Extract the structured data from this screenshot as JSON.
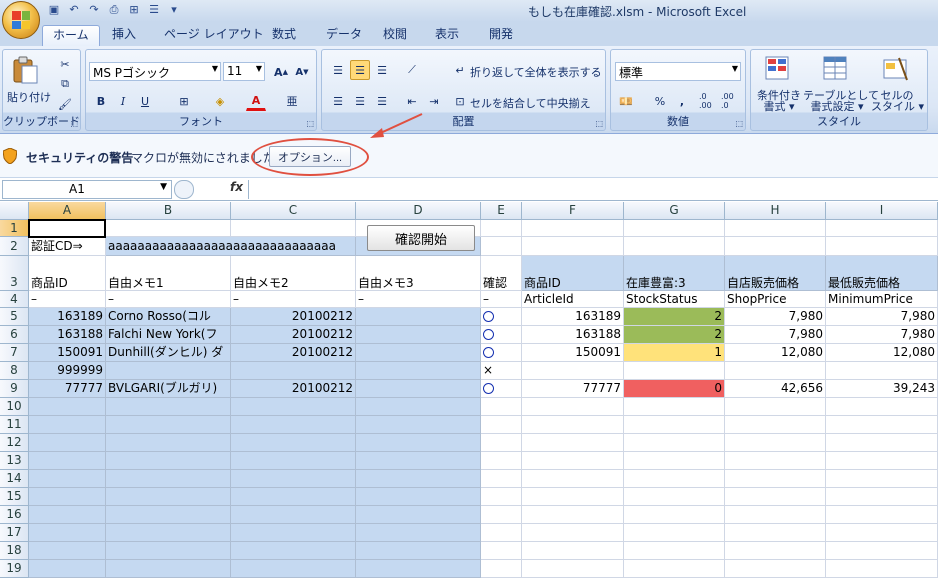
{
  "title": "もしも在庫確認.xlsm - Microsoft Excel",
  "tabs": [
    "ホーム",
    "挿入",
    "ページ レイアウト",
    "数式",
    "データ",
    "校閲",
    "表示",
    "開発"
  ],
  "clipboard": {
    "paste": "貼り付け",
    "group": "クリップボード"
  },
  "font": {
    "name": "MS Pゴシック",
    "size": "11",
    "group": "フォント"
  },
  "align": {
    "wrap": "折り返して全体を表示する",
    "merge": "セルを結合して中央揃え",
    "group": "配置"
  },
  "number": {
    "format": "標準",
    "group": "数値"
  },
  "styles": {
    "cond1": "条件付き",
    "cond2": "書式",
    "table1": "テーブルとして",
    "table2": "書式設定",
    "cell1": "セルの",
    "cell2": "スタイル",
    "group": "スタイル"
  },
  "security": {
    "title": "セキュリティの警告",
    "message": "マクロが無効にされました。",
    "options": "オプション..."
  },
  "formula": {
    "namebox": "A1",
    "fx": "fx",
    "value": ""
  },
  "columns": [
    "A",
    "B",
    "C",
    "D",
    "E",
    "F",
    "G",
    "H",
    "I"
  ],
  "rows": [
    "1",
    "2",
    "3",
    "4",
    "5",
    "6",
    "7",
    "8",
    "9",
    "10",
    "11",
    "12",
    "13",
    "14",
    "15",
    "16",
    "17",
    "18",
    "19"
  ],
  "start_button": "確認開始",
  "row2": {
    "label": "認証CD⇒",
    "value": "aaaaaaaaaaaaaaaaaaaaaaaaaaaaaaa"
  },
  "headers": [
    "商品ID",
    "自由メモ1",
    "自由メモ2",
    "自由メモ3",
    "確認",
    "商品ID",
    "在庫豊富:3",
    "自店販売価格",
    "最低販売価格"
  ],
  "subheaders": [
    "–",
    "–",
    "–",
    "–",
    "–",
    "ArticleId",
    "StockStatus",
    "ShopPrice",
    "MinimumPrice"
  ],
  "data": [
    {
      "a": "163189",
      "b": "Corno Rosso(コル",
      "c": "20100212",
      "e": "circle",
      "f": "163189",
      "g": "2",
      "h": "7,980",
      "i": "7,980",
      "gcolor": "#9bbb59"
    },
    {
      "a": "163188",
      "b": "Falchi New York(フ",
      "c": "20100212",
      "e": "circle",
      "f": "163188",
      "g": "2",
      "h": "7,980",
      "i": "7,980",
      "gcolor": "#9bbb59"
    },
    {
      "a": "150091",
      "b": "Dunhill(ダンヒル) ダ",
      "c": "20100212",
      "e": "circle",
      "f": "150091",
      "g": "1",
      "h": "12,080",
      "i": "12,080",
      "gcolor": "#ffe27a"
    },
    {
      "a": "999999",
      "b": "",
      "c": "",
      "e": "×",
      "f": "",
      "g": "",
      "h": "",
      "i": "",
      "gcolor": ""
    },
    {
      "a": "77777",
      "b": "BVLGARI(ブルガリ)",
      "c": "20100212",
      "e": "circle",
      "f": "77777",
      "g": "0",
      "h": "42,656",
      "i": "39,243",
      "gcolor": "#f06060"
    }
  ]
}
